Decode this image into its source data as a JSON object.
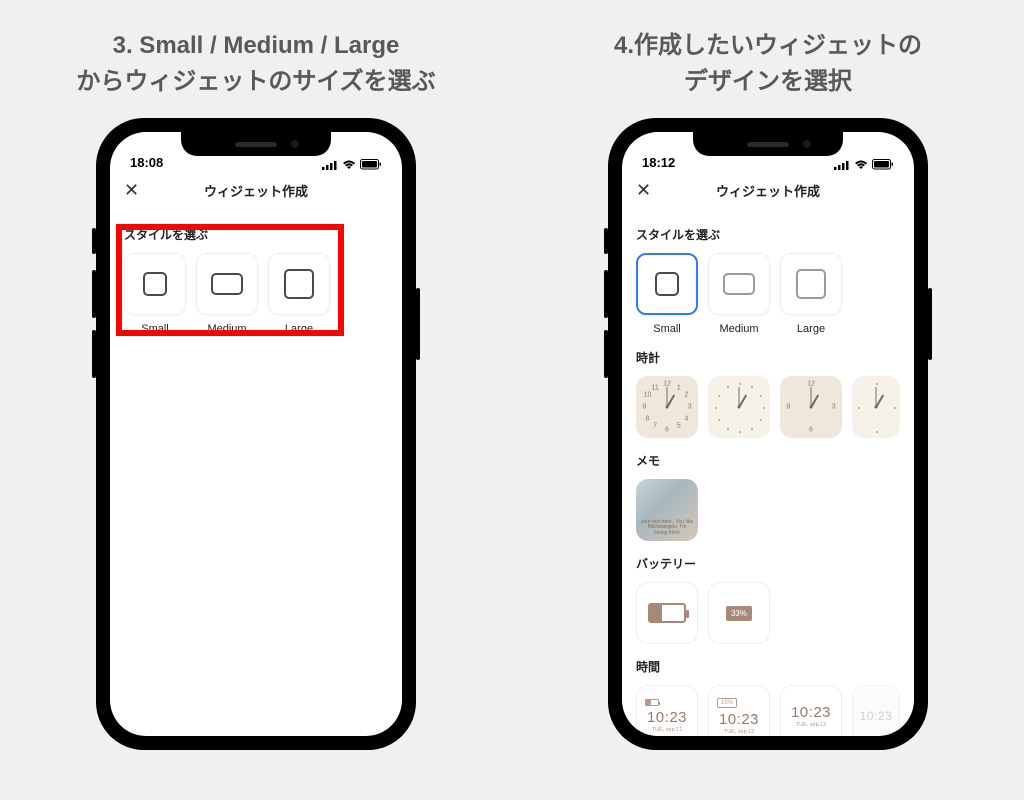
{
  "left": {
    "title_line1": "3. Small / Medium / Large",
    "title_line2": "からウィジェットのサイズを選ぶ",
    "phone": {
      "time": "18:08",
      "nav_title": "ウィジェット作成",
      "section_style": "スタイルを選ぶ",
      "sizes": [
        "Small",
        "Medium",
        "Large"
      ]
    }
  },
  "right": {
    "title_line1": "4.作成したいウィジェットの",
    "title_line2": "デザインを選択",
    "phone": {
      "time": "18:12",
      "nav_title": "ウィジェット作成",
      "section_style": "スタイルを選ぶ",
      "sizes": [
        "Small",
        "Medium",
        "Large"
      ],
      "section_clock": "時計",
      "section_memo": "メモ",
      "memo_text": "your text here.. You like Michelangelo, I'm loving Klimt",
      "section_battery": "バッテリー",
      "battery_pct": "33%",
      "section_time": "時間",
      "time_value": "10:23",
      "time_sub": "TUE, sep.12",
      "time_pct": "15%"
    }
  },
  "clock_numbers": [
    "12",
    "1",
    "2",
    "3",
    "4",
    "5",
    "6",
    "7",
    "8",
    "9",
    "10",
    "11"
  ]
}
